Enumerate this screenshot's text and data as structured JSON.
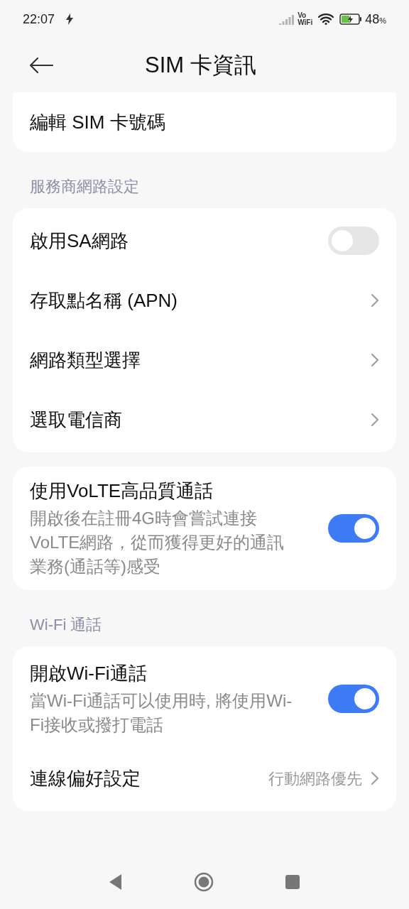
{
  "status_bar": {
    "time": "22:07",
    "vowifi": [
      "Vo",
      "WiFi"
    ],
    "battery": "48",
    "percent": "%"
  },
  "header": {
    "title": "SIM 卡資訊"
  },
  "sections": [
    {
      "cards": [
        [
          {
            "kind": "link",
            "label": "編輯 SIM 卡號碼",
            "chevron": false
          }
        ]
      ]
    },
    {
      "heading": "服務商網路設定",
      "cards": [
        [
          {
            "kind": "switch",
            "label": "啟用SA網路",
            "on": false
          },
          {
            "kind": "link",
            "label": "存取點名稱 (APN)",
            "chevron": true
          },
          {
            "kind": "link",
            "label": "網路類型選擇",
            "chevron": true
          },
          {
            "kind": "link",
            "label": "選取電信商",
            "chevron": true
          }
        ],
        [
          {
            "kind": "switch",
            "label": "使用VoLTE高品質通話",
            "description": "開啟後在註冊4G時會嘗試連接VoLTE網路，從而獲得更好的通訊業務(通話等)感受",
            "on": true
          }
        ]
      ]
    },
    {
      "heading": "Wi-Fi 通話",
      "cards": [
        [
          {
            "kind": "switch",
            "label": "開啟Wi-Fi通話",
            "description": "當Wi-Fi通話可以使用時, 將使用Wi-Fi接收或撥打電話",
            "on": true
          },
          {
            "kind": "link",
            "label": "連線偏好設定",
            "value": "行動網路優先",
            "chevron": true
          }
        ]
      ]
    }
  ]
}
